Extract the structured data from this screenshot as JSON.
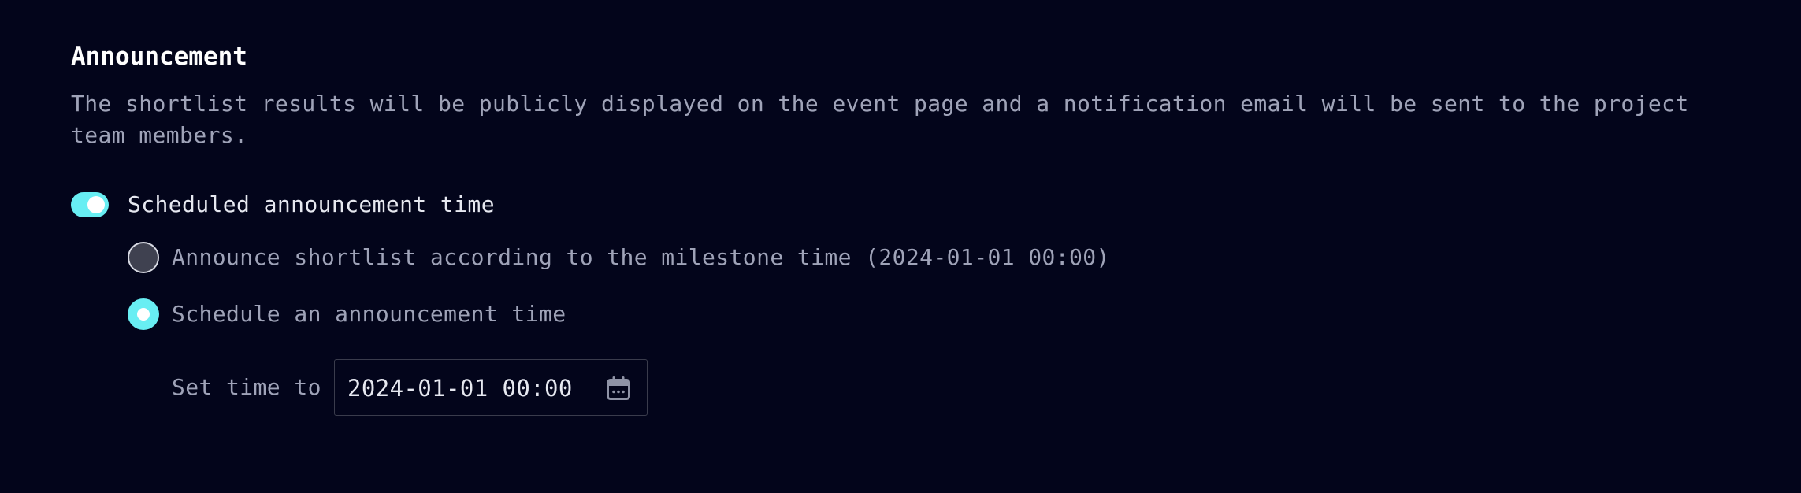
{
  "announcement": {
    "title": "Announcement",
    "description": "The shortlist results will be publicly displayed on the event page and a notification email will be sent to the project team members."
  },
  "scheduled_toggle": {
    "label": "Scheduled announcement time",
    "checked": true
  },
  "options": [
    {
      "label": "Announce shortlist according to the milestone time (2024-01-01 00:00)",
      "selected": false
    },
    {
      "label": "Schedule an announcement time",
      "selected": true
    }
  ],
  "set_time": {
    "label": "Set time to",
    "value": "2024-01-01 00:00",
    "icon": "calendar-icon"
  },
  "colors": {
    "background": "#03051b",
    "accent": "#68eef3",
    "title": "#ffffff",
    "muted_text": "#9fa3b8",
    "input_border": "#3a3c4c"
  }
}
